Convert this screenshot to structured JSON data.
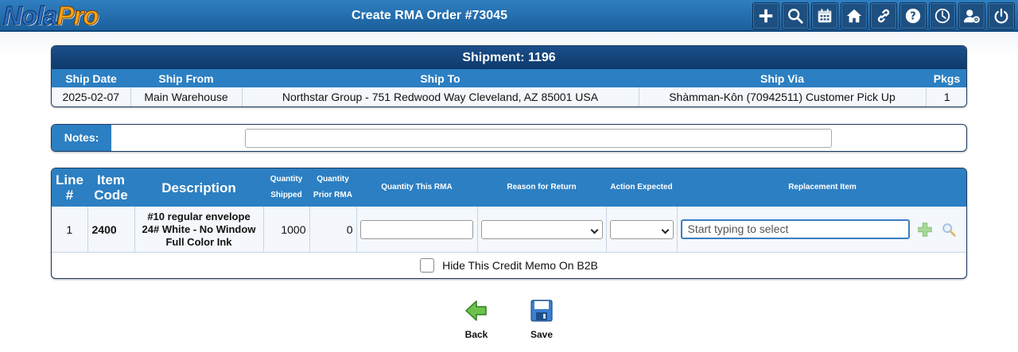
{
  "app": {
    "logo_part1": "Nola",
    "logo_part2": "Pro",
    "page_title": "Create RMA Order #73045"
  },
  "toolbar": {
    "icons": [
      "plus-icon",
      "search-icon",
      "calendar-icon",
      "home-icon",
      "link-icon",
      "help-icon",
      "clock-icon",
      "user-settings-icon",
      "power-icon"
    ]
  },
  "shipment": {
    "title": "Shipment: 1196",
    "headers": [
      "Ship Date",
      "Ship From",
      "Ship To",
      "Ship Via",
      "Pkgs"
    ],
    "row": [
      "2025-02-07",
      "Main Warehouse",
      "Northstar Group - 751 Redwood Way Cleveland, AZ 85001 USA",
      "Shàmman-Kôn (70942511) Customer Pick Up",
      "1"
    ]
  },
  "notes": {
    "label": "Notes:",
    "value": ""
  },
  "items": {
    "headers": {
      "line": "Line #",
      "item_code": "Item Code",
      "description": "Description",
      "qty_shipped": "Quantity Shipped",
      "qty_prior": "Quantity Prior RMA",
      "qty_this": "Quantity This RMA",
      "reason": "Reason for Return",
      "action": "Action Expected",
      "replacement": "Replacement Item"
    },
    "rows": [
      {
        "line": "1",
        "item_code": "2400",
        "description": "#10 regular envelope 24# White - No Window Full Color Ink",
        "qty_shipped": "1000",
        "qty_prior": "0",
        "qty_this": "",
        "reason": "",
        "action": "",
        "replacement_placeholder": "Start typing to select"
      }
    ],
    "hide_credit_label": "Hide This Credit Memo On B2B",
    "hide_credit_checked": false
  },
  "actions": {
    "back": "Back",
    "save": "Save"
  },
  "colors": {
    "header_blue": "#2c7fc2",
    "title_navy": "#0e3a6b",
    "topbar": "#1b5f9c",
    "back_green": "#4caf50",
    "save_blue": "#3b7fd0"
  }
}
